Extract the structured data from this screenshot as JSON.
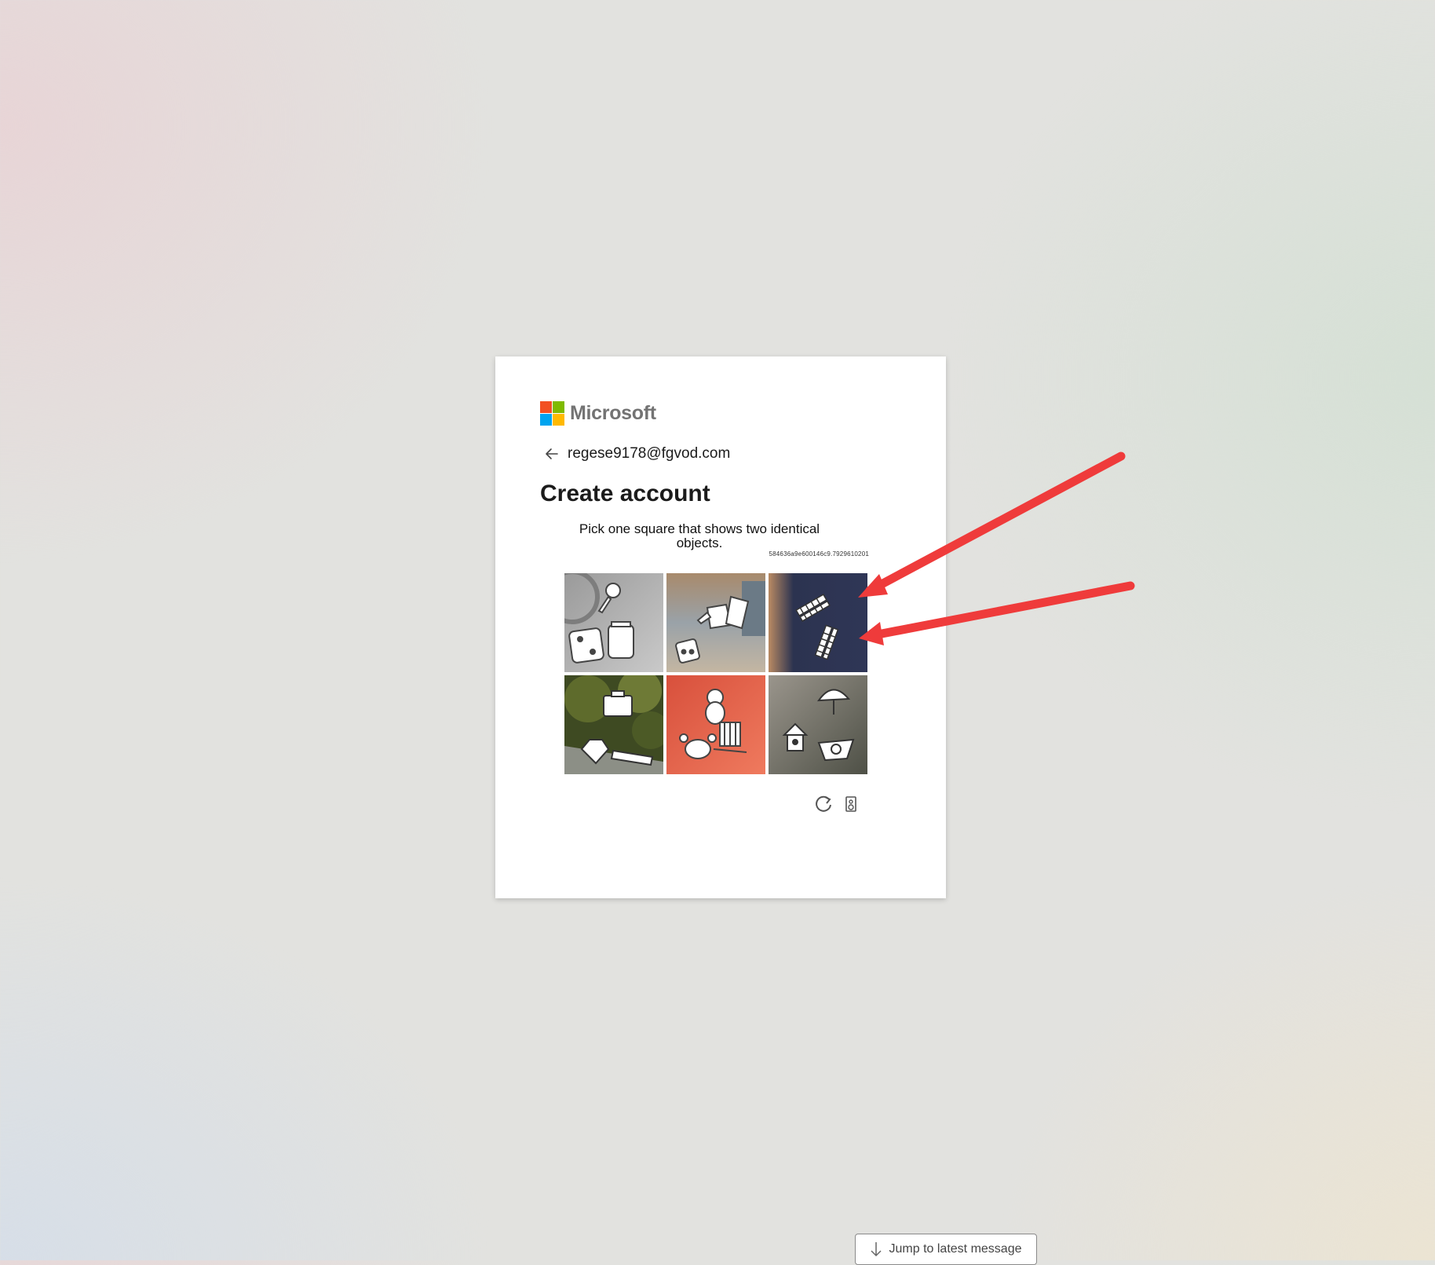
{
  "brand": {
    "name": "Microsoft",
    "colors": [
      "#f25022",
      "#7fba00",
      "#00a4ef",
      "#ffb900"
    ]
  },
  "identity": {
    "email": "regese9178@fgvod.com",
    "back_icon": "arrow-left-icon"
  },
  "title": "Create account",
  "captcha": {
    "prompt": "Pick one square that shows two identical objects.",
    "code": "584636a9e600146c9.7929610201",
    "tiles": [
      {
        "label": "Tile 1",
        "icons": [
          "microphone",
          "die",
          "jar"
        ]
      },
      {
        "label": "Tile 2",
        "icons": [
          "watering-can",
          "book",
          "die"
        ]
      },
      {
        "label": "Tile 3",
        "icons": [
          "bench",
          "bench"
        ]
      },
      {
        "label": "Tile 4",
        "icons": [
          "briefcase",
          "gem",
          "telescope"
        ]
      },
      {
        "label": "Tile 5",
        "icons": [
          "teddy-bear",
          "crab",
          "barrier"
        ]
      },
      {
        "label": "Tile 6",
        "icons": [
          "umbrella",
          "birdhouse",
          "boat"
        ]
      }
    ],
    "controls": [
      "refresh-icon",
      "audio-icon"
    ]
  },
  "annotation": {
    "arrow_color": "#ef3b3b",
    "points_to": "Tile 3"
  },
  "jump_button": {
    "label": "Jump to latest message"
  }
}
